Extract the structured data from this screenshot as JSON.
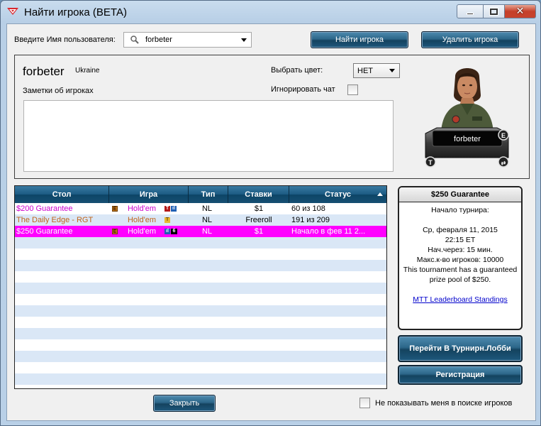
{
  "window": {
    "title": "Найти игрока (BETA)"
  },
  "search": {
    "label": "Введите Имя пользователя:",
    "value": "forbeter",
    "find_button": "Найти игрока",
    "delete_button": "Удалить игрока"
  },
  "player": {
    "name": "forbeter",
    "country": "Ukraine",
    "color_label": "Выбрать цвет:",
    "color_value": "НЕТ",
    "ignore_chat_label": "Игнорировать чат",
    "notes_label": "Заметки об игроках",
    "notes_value": "",
    "avatar_name": "forbeter"
  },
  "table": {
    "headers": [
      "Стол",
      "Игра",
      "Тип",
      "Ставки",
      "Статус"
    ],
    "rows": [
      {
        "name": "$200 Guarantee",
        "game": "Hold'em",
        "type": "NL",
        "stakes": "$1",
        "status": "60 из 108",
        "color": "#cc00cc",
        "icons": [
          "t",
          "bar"
        ],
        "name_icon": "e",
        "selected": false
      },
      {
        "name": "The Daily Edge - RGT",
        "game": "Hold'em",
        "type": "NL",
        "stakes": "Freeroll",
        "status": "191 из 209",
        "color": "#c0641a",
        "icons": [
          "trophy"
        ],
        "name_icon": "",
        "selected": false
      },
      {
        "name": "$250 Guarantee",
        "game": "Hold'em",
        "type": "NL",
        "stakes": "$1",
        "status": "Начало в фев 11 2...",
        "color": "#ffffff",
        "icons": [
          "bar",
          "six"
        ],
        "name_icon": "e",
        "selected": true
      }
    ]
  },
  "tournament": {
    "title": "$250 Guarantee",
    "start_label": "Начало турнира:",
    "date": "Ср, февраля 11, 2015",
    "time": "22:15 ET",
    "starts_in": "Нач.через: 15 мин.",
    "max_players": "Макс.к-во игроков: 10000",
    "description": "This tournament has a guaranteed prize pool of $250.",
    "link": "MTT Leaderboard Standings",
    "lobby_button": "Перейти В Турнирн.Лобби",
    "register_button": "Регистрация"
  },
  "footer": {
    "close_button": "Закрыть",
    "hide_me_label": "Не показывать меня в поиске игроков"
  },
  "icons": [
    "app-logo-icon",
    "minimize-icon",
    "maximize-icon",
    "close-icon",
    "search-icon",
    "dropdown-arrow-icon",
    "sort-asc-icon"
  ],
  "colors": {
    "selected_row": "#ff00ff",
    "header_blue": "#1b5a82",
    "alt_row": "#dae7f6",
    "link": "#0000cc"
  }
}
